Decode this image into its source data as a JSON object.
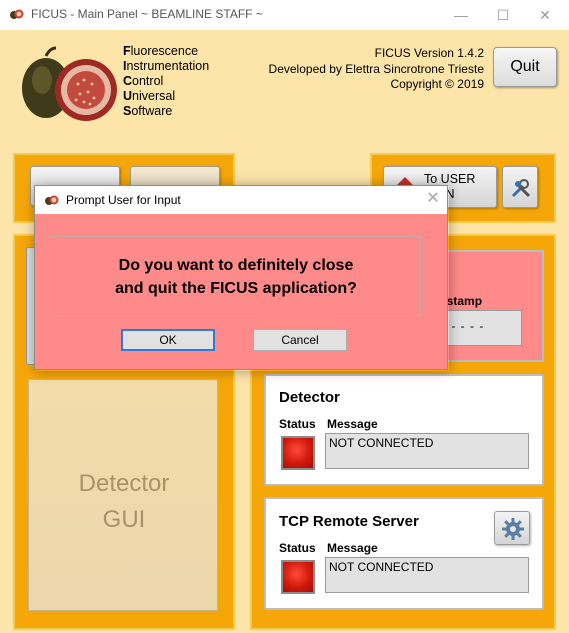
{
  "window": {
    "title": "FICUS - Main Panel ~ BEAMLINE STAFF ~",
    "controls": [
      "minimize-icon",
      "maximize-icon",
      "close-icon"
    ]
  },
  "header": {
    "acronym": [
      {
        "first": "F",
        "rest": "luorescence"
      },
      {
        "first": "I",
        "rest": "nstrumentation"
      },
      {
        "first": "C",
        "rest": "ontrol"
      },
      {
        "first": "U",
        "rest": "niversal"
      },
      {
        "first": "S",
        "rest": "oftware"
      }
    ],
    "version": "FICUS Version 1.4.2",
    "developer": "Developed by Elettra Sincrotrone Trieste",
    "copyright": "Copyright © 2019",
    "quit_label": "Quit"
  },
  "toolbar": {
    "to_user_label_1": "To USER",
    "to_user_label_2": "SION",
    "settings_icon": "wrench-screwdriver-icon"
  },
  "panels": {
    "partial_label": "estamp",
    "partial_value": "- - - - -",
    "detector_gui_line1": "Detector",
    "detector_gui_line2": "GUI",
    "detector": {
      "title": "Detector",
      "status_label": "Status",
      "message_label": "Message",
      "message": "NOT CONNECTED"
    },
    "tcp": {
      "title": "TCP Remote Server",
      "status_label": "Status",
      "message_label": "Message",
      "message": "NOT CONNECTED",
      "icon": "gear-icon"
    }
  },
  "dialog": {
    "title": "Prompt User for Input",
    "message_line1": "Do you want to definitely close",
    "message_line2": "and quit the FICUS application?",
    "ok_label": "OK",
    "cancel_label": "Cancel"
  },
  "colors": {
    "background": "#fde4a8",
    "frame": "#f5a70a",
    "dialog_bg": "#ff8a8a",
    "led_red": "#d11a0c"
  }
}
